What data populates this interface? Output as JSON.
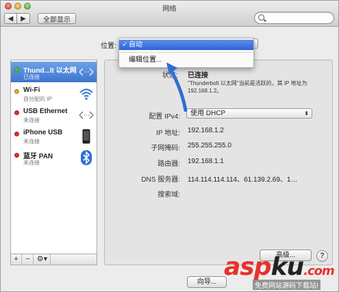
{
  "window": {
    "title": "网络"
  },
  "toolbar": {
    "back": "◀",
    "forward": "▶",
    "show_all": "全部显示",
    "search_placeholder": ""
  },
  "location": {
    "label": "位置:"
  },
  "location_menu": {
    "selected": "自动",
    "check": "✓",
    "edit": "编辑位置..."
  },
  "services": [
    {
      "name": "Thund...lt 以太网",
      "status": "已连接",
      "dot_color": "#4cc23a",
      "icon": "ethernet-arrows-icon",
      "selected": true
    },
    {
      "name": "Wi-Fi",
      "status": "自分配的 IP",
      "dot_color": "#e9a825",
      "icon": "wifi-icon",
      "selected": false
    },
    {
      "name": "USB Ethernet",
      "status": "未连接",
      "dot_color": "#d8322b",
      "icon": "ethernet-arrows-icon",
      "selected": false
    },
    {
      "name": "iPhone USB",
      "status": "未连接",
      "dot_color": "#d8322b",
      "icon": "iphone-icon",
      "selected": false
    },
    {
      "name": "蓝牙 PAN",
      "status": "未连接",
      "dot_color": "#d8322b",
      "icon": "bluetooth-icon",
      "selected": false
    }
  ],
  "sidebar_buttons": {
    "add": "+",
    "remove": "−",
    "gear": "⚙▾"
  },
  "detail": {
    "status_label": "状态:",
    "status_value": "已连接",
    "status_desc": "\"Thunderbolt 以太网\"当前是活跃的，其 IP 地址为 192.168.1.2。",
    "config_label": "配置 IPv4:",
    "config_value": "使用 DHCP",
    "ip_label": "IP 地址:",
    "ip_value": "192.168.1.2",
    "mask_label": "子网掩码:",
    "mask_value": "255.255.255.0",
    "router_label": "路由器:",
    "router_value": "192.168.1.1",
    "dns_label": "DNS 服务器:",
    "dns_value": "114.114.114.114、61.139.2.69、1…",
    "search_domain_label": "搜索域:",
    "advanced_button": "高级...",
    "help": "?"
  },
  "footer": {
    "assist_button": "向导..."
  },
  "watermark": {
    "logo_a": "asp",
    "logo_b": "ku",
    "logo_c": ".com",
    "sub": "免费网站源码下载站!"
  }
}
